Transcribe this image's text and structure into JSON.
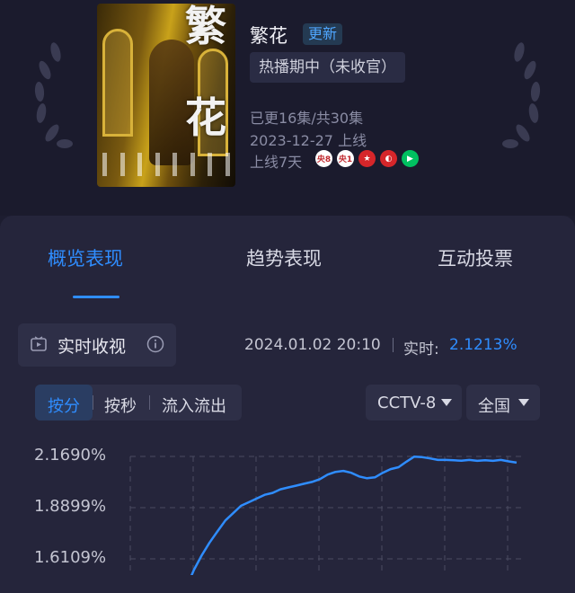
{
  "show": {
    "title": "繁花",
    "update_badge": "更新",
    "status": "热播期中（未收官）",
    "episodes": "已更16集/共30集",
    "release": "2023-12-27 上线",
    "online_days": "上线7天",
    "channels": [
      {
        "icon": "cctv8-icon",
        "label": "央8",
        "bg": "#ffffff",
        "fg": "#c0282d"
      },
      {
        "icon": "cctv1-icon",
        "label": "央1",
        "bg": "#ffffff",
        "fg": "#c0282d"
      },
      {
        "icon": "star-channel-icon",
        "label": "★",
        "bg": "#d6262a",
        "fg": "#ffffff"
      },
      {
        "icon": "tencent-video-icon",
        "label": "◐",
        "bg": "#d6262a",
        "fg": "#ffffff"
      },
      {
        "icon": "iqiyi-play-icon",
        "label": "▶",
        "bg": "#00c060",
        "fg": "#ffffff"
      }
    ],
    "poster": {
      "big_title_chars": [
        "繁",
        "花"
      ]
    }
  },
  "tabs": [
    {
      "label": "概览表现",
      "active": true
    },
    {
      "label": "趋势表现",
      "active": false
    },
    {
      "label": "互动投票",
      "active": false
    }
  ],
  "realtime": {
    "label": "实时收视",
    "time": "2024.01.02 20:10",
    "now_label": "实时:",
    "now_value": "2.1213%"
  },
  "segment": {
    "items": [
      {
        "label": "按分",
        "active": true
      },
      {
        "label": "按秒",
        "active": false
      },
      {
        "label": "流入流出",
        "active": false
      }
    ]
  },
  "dropdowns": {
    "channel": "CCTV-8",
    "region": "全国"
  },
  "colors": {
    "accent": "#2f8dff",
    "background": "#1d1d30",
    "card": "#25253b"
  },
  "chart_data": {
    "type": "line",
    "y_ticks": [
      "2.1690%",
      "1.8899%",
      "1.6109%"
    ],
    "ylim": [
      1.45,
      2.169
    ],
    "series": [
      {
        "color": "#2f8dff",
        "points": [
          [
            0,
            1.45
          ],
          [
            1,
            1.55
          ],
          [
            2,
            1.63
          ],
          [
            3,
            1.7
          ],
          [
            4,
            1.76
          ],
          [
            5,
            1.82
          ],
          [
            6,
            1.86
          ],
          [
            7,
            1.9
          ],
          [
            8,
            1.92
          ],
          [
            9,
            1.94
          ],
          [
            10,
            1.96
          ],
          [
            11,
            1.97
          ],
          [
            12,
            1.99
          ],
          [
            13,
            2.0
          ],
          [
            14,
            2.01
          ],
          [
            15,
            2.02
          ],
          [
            16,
            2.03
          ],
          [
            17,
            2.045
          ],
          [
            18,
            2.07
          ],
          [
            19,
            2.085
          ],
          [
            20,
            2.09
          ],
          [
            21,
            2.08
          ],
          [
            22,
            2.06
          ],
          [
            23,
            2.05
          ],
          [
            24,
            2.055
          ],
          [
            25,
            2.08
          ],
          [
            26,
            2.1
          ],
          [
            27,
            2.11
          ],
          [
            28,
            2.14
          ],
          [
            29,
            2.168
          ],
          [
            30,
            2.165
          ],
          [
            31,
            2.158
          ],
          [
            32,
            2.15
          ],
          [
            33,
            2.15
          ],
          [
            34,
            2.148
          ],
          [
            35,
            2.146
          ],
          [
            36,
            2.15
          ],
          [
            37,
            2.145
          ],
          [
            38,
            2.148
          ],
          [
            39,
            2.145
          ],
          [
            40,
            2.15
          ],
          [
            41,
            2.142
          ],
          [
            42,
            2.135
          ]
        ]
      }
    ]
  }
}
